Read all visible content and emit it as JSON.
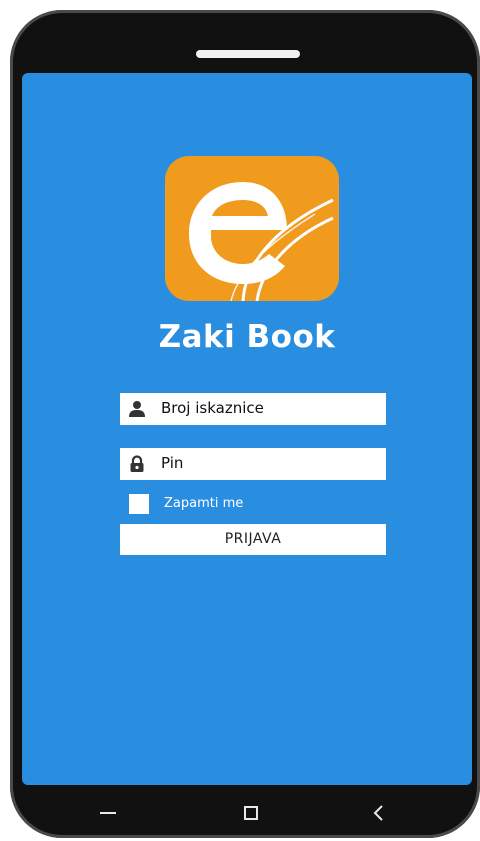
{
  "app": {
    "title": "Zaki Book",
    "logo_letter": "e"
  },
  "login": {
    "username_label": "Broj iskaznice",
    "pin_label": "Pin",
    "remember_label": "Zapamti me",
    "remember_checked": false,
    "submit_label": "PRIJAVA"
  },
  "icons": {
    "username": "user-icon",
    "pin": "lock-icon",
    "nav_menu": "menu-icon",
    "nav_home": "square-home-icon",
    "nav_back": "chevron-left-icon"
  },
  "colors": {
    "screen_background": "#2a8ee0",
    "logo_background": "#f09a1e",
    "text_light": "#ffffff"
  }
}
